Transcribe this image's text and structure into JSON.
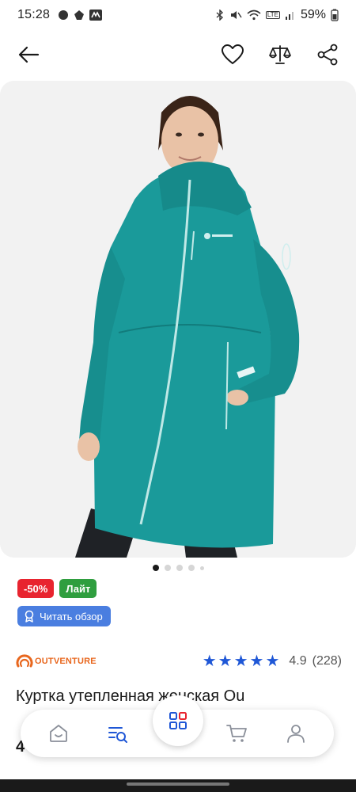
{
  "status_bar": {
    "time": "15:28",
    "battery": "59%",
    "network_label": "LTE"
  },
  "header": {
    "back_icon": "arrow-left-icon",
    "favorite_icon": "heart-icon",
    "compare_icon": "scales-icon",
    "share_icon": "share-icon"
  },
  "gallery": {
    "total_dots": 5,
    "active_index": 0
  },
  "badges": {
    "discount": "-50%",
    "tier": "Лайт"
  },
  "review": {
    "label": "Читать обзор"
  },
  "brand": {
    "name": "OUTVENTURE"
  },
  "rating": {
    "stars": 5,
    "value": "4.9",
    "count": "(228)"
  },
  "product": {
    "title": "Куртка утепленная женская Ou",
    "price_visible": "4"
  },
  "bottom_nav": {
    "items": [
      "home-icon",
      "catalog-search-icon",
      "grid-icon",
      "cart-icon",
      "profile-icon"
    ]
  },
  "colors": {
    "accent": "#1f57d6",
    "sale": "#e8242f",
    "lite": "#2f9e3f",
    "review": "#4a7ee0",
    "brand": "#e8671e",
    "jacket": "#1a9a9a"
  }
}
